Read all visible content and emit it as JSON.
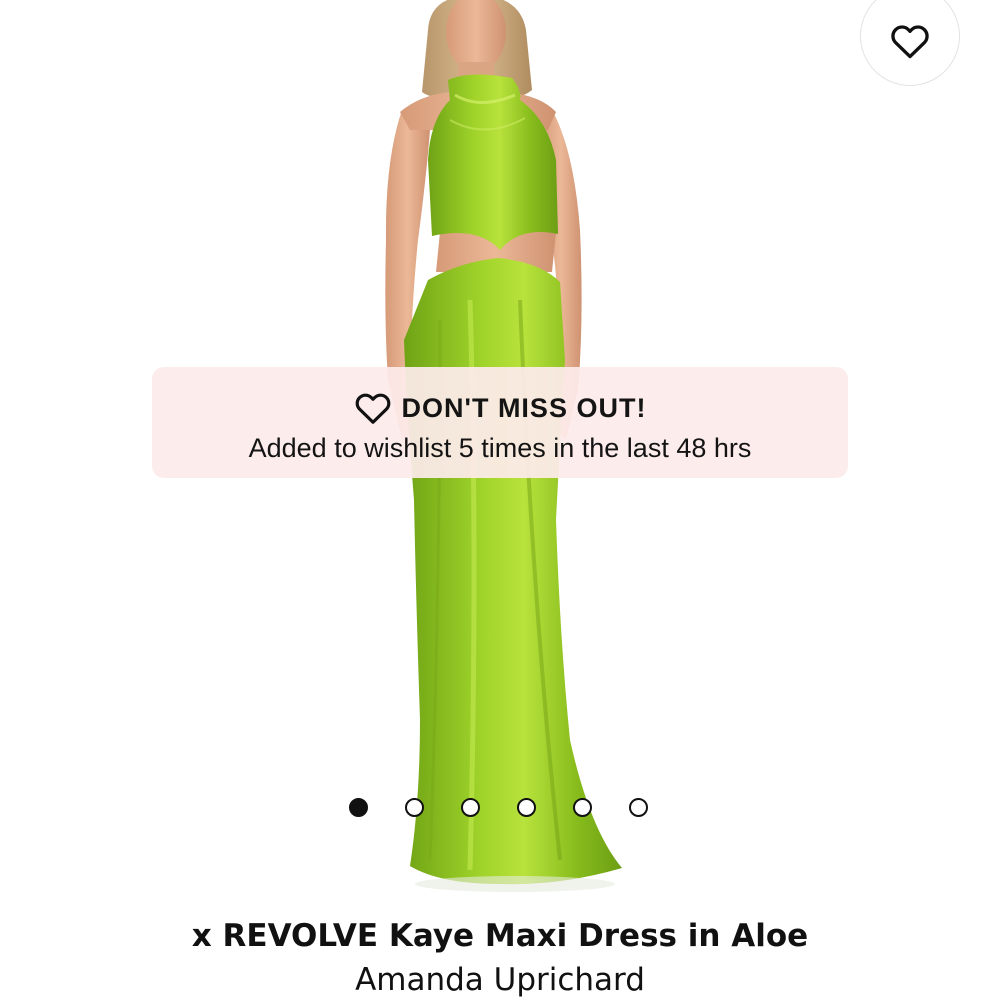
{
  "product_image": {
    "icon": "product-photo-green-satin-maxi-dress",
    "dress_color": "#8dc21f"
  },
  "wishlist_button": {
    "icon": "heart-icon"
  },
  "toast": {
    "icon": "heart-icon",
    "title": "DON'T MISS OUT!",
    "message": "Added to wishlist 5 times in the last 48 hrs",
    "background": "#fdebeb"
  },
  "carousel": {
    "total_images": 6,
    "active_index": 0
  },
  "product": {
    "name": "x REVOLVE Kaye Maxi Dress in Aloe",
    "brand": "Amanda Uprichard"
  }
}
